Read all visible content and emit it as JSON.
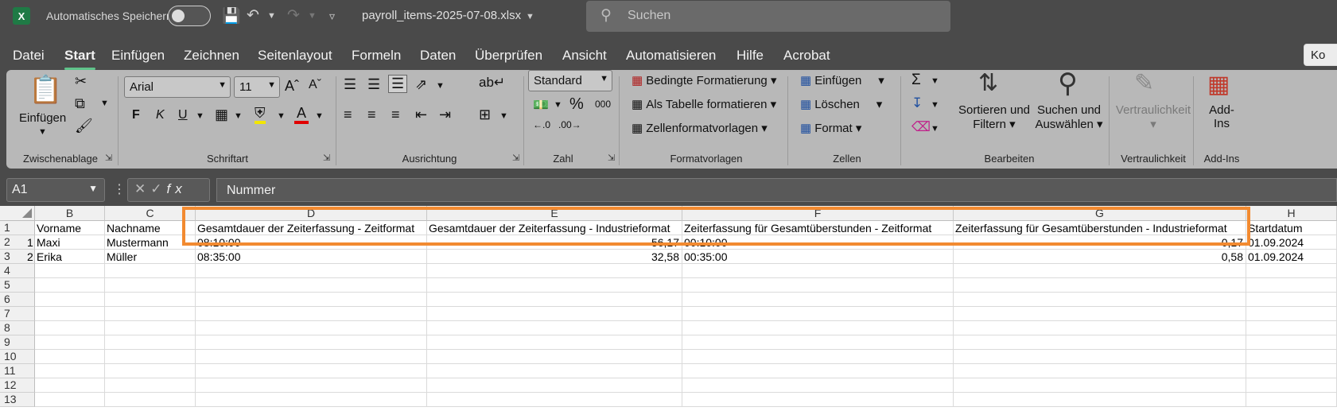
{
  "app": {
    "autosave_label": "Automatisches Speichern",
    "filename": "payroll_items-2025-07-08.xlsx",
    "search_placeholder": "Suchen",
    "logo_letter": "X"
  },
  "menu": [
    "Datei",
    "Start",
    "Einfügen",
    "Zeichnen",
    "Seitenlayout",
    "Formeln",
    "Daten",
    "Überprüfen",
    "Ansicht",
    "Automatisieren",
    "Hilfe",
    "Acrobat"
  ],
  "share_label": "Ko",
  "ribbon": {
    "clipboard": {
      "paste": "Einfügen",
      "group": "Zwischenablage"
    },
    "font": {
      "name": "Arial",
      "size": "11",
      "bold": "F",
      "italic": "K",
      "underline": "U",
      "font_color": "A",
      "group": "Schriftart"
    },
    "alignment": {
      "group": "Ausrichtung"
    },
    "number": {
      "format": "Standard",
      "percent": "%",
      "thousands": "000",
      "group": "Zahl"
    },
    "styles": {
      "conditional": "Bedingte Formatierung",
      "as_table": "Als Tabelle formatieren",
      "cell_styles": "Zellenformatvorlagen",
      "group": "Formatvorlagen"
    },
    "cells": {
      "insert": "Einfügen",
      "delete": "Löschen",
      "format": "Format",
      "group": "Zellen"
    },
    "editing": {
      "sort": "Sortieren und",
      "sort2": "Filtern",
      "find": "Suchen und",
      "find2": "Auswählen",
      "group": "Bearbeiten"
    },
    "sensitivity": {
      "label": "Vertraulichkeit",
      "group": "Vertraulichkeit"
    },
    "addins": {
      "label": "Add-",
      "label2": "Ins",
      "group": "Add-Ins"
    }
  },
  "formula_bar": {
    "name_box": "A1",
    "content": "Nummer"
  },
  "columns": [
    "B",
    "C",
    "D",
    "E",
    "F",
    "G",
    "H"
  ],
  "rows": [
    {
      "num": "1",
      "a": "",
      "b": "Vorname",
      "c": "Nachname",
      "d": "Gesamtdauer der Zeiterfassung - Zeitformat",
      "e": "Gesamtdauer der Zeiterfassung - Industrieformat",
      "f": "Zeiterfassung für Gesamtüberstunden - Zeitformat",
      "g": "Zeiterfassung für Gesamtüberstunden - Industrieformat",
      "h": "Startdatum"
    },
    {
      "num": "2",
      "a": "1",
      "b": "Maxi",
      "c": "Mustermann",
      "d": "08:10:00",
      "e": "56,17",
      "f": "00:10:00",
      "g": "0,17",
      "h": "01.09.2024"
    },
    {
      "num": "3",
      "a": "2",
      "b": "Erika",
      "c": "Müller",
      "d": "08:35:00",
      "e": "32,58",
      "f": "00:35:00",
      "g": "0,58",
      "h": "01.09.2024"
    },
    {
      "num": "4"
    },
    {
      "num": "5"
    },
    {
      "num": "6"
    },
    {
      "num": "7"
    },
    {
      "num": "8"
    },
    {
      "num": "9"
    },
    {
      "num": "10"
    },
    {
      "num": "11"
    },
    {
      "num": "12"
    },
    {
      "num": "13"
    }
  ]
}
